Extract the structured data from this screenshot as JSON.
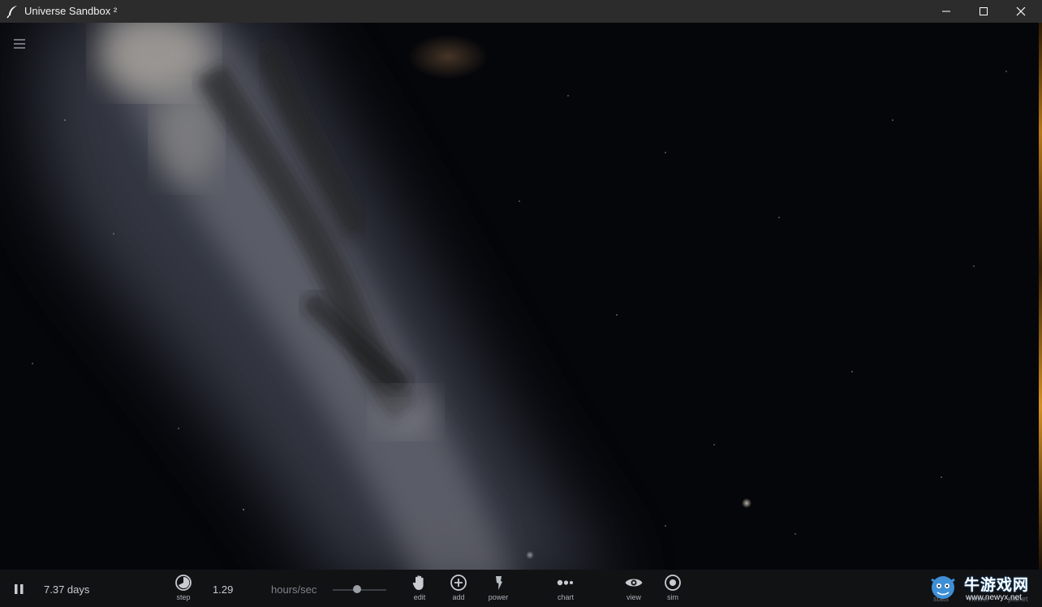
{
  "window": {
    "title": "Universe Sandbox ²"
  },
  "time": {
    "date": "7.37 days",
    "rate": "1.29",
    "unit": "hours/sec",
    "speed_fraction": 0.45
  },
  "toolbar": {
    "step": "step",
    "edit": "edit",
    "add": "add",
    "power": "power",
    "chart": "chart",
    "view": "view",
    "sim": "sim",
    "stats": "stats",
    "viewer": "viewer",
    "planet": "planet"
  },
  "watermark": {
    "text": "牛游戏网",
    "url": "www.newyx.net"
  },
  "colors": {
    "titlebar": "#2c2c2c",
    "bottombar": "#111214",
    "accent_strip": "#b77818"
  },
  "icons": [
    "app-feather-icon",
    "minimize-icon",
    "maximize-icon",
    "close-icon",
    "menu-icon",
    "pause-icon",
    "step-icon",
    "hand-icon",
    "plus-circle-icon",
    "power-lightning-icon",
    "chart-dots-icon",
    "eye-icon",
    "sim-target-icon"
  ]
}
